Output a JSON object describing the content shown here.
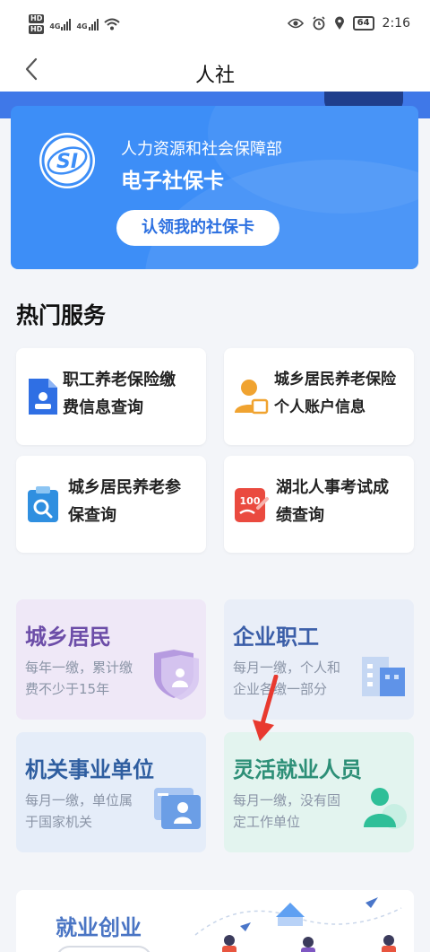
{
  "status_bar": {
    "network_badges": [
      "HD",
      "HD"
    ],
    "network_types": [
      "4G",
      "4G"
    ],
    "battery": "64",
    "time": "2:16"
  },
  "nav": {
    "title": "人社",
    "back_icon": "chevron-left-icon"
  },
  "card": {
    "org": "人力资源和社会保障部",
    "title": "电子社保卡",
    "button": "认领我的社保卡",
    "logo_text": "SI"
  },
  "hot_services": {
    "title": "热门服务",
    "items": [
      {
        "line1": "职工养老保险缴",
        "line2": "费信息查询",
        "icon": "document-icon",
        "color": "#2f6fe4"
      },
      {
        "line1": "城乡居民养老保险",
        "line2": "个人账户信息",
        "icon": "user-card-icon",
        "color": "#f0a330"
      },
      {
        "line1": "城乡居民养老参",
        "line2": "保查询",
        "icon": "search-clipboard-icon",
        "color": "#2f8fe0"
      },
      {
        "line1": "湖北人事考试成",
        "line2": "绩查询",
        "icon": "score-icon",
        "color": "#ea4a3f"
      }
    ]
  },
  "categories": [
    {
      "title": "城乡居民",
      "sub": "每年一缴，累计缴费不少于15年",
      "bg": "#efe8f7",
      "title_color": "#6c4da8",
      "icon": "shield-user-icon"
    },
    {
      "title": "企业职工",
      "sub": "每月一缴，个人和企业各缴一部分",
      "bg": "#e9eef8",
      "title_color": "#3b5ea8",
      "icon": "building-icon"
    },
    {
      "title": "机关事业单位",
      "sub": "每月一缴，单位属于国家机关",
      "bg": "#e5edf9",
      "title_color": "#2f5ea0",
      "icon": "id-card-icon"
    },
    {
      "title": "灵活就业人员",
      "sub": "每月一缴，没有固定工作单位",
      "bg": "#e3f4ef",
      "title_color": "#2d8f77",
      "icon": "person-icon"
    }
  ],
  "bottom": {
    "title": "就业创业"
  },
  "colors": {
    "primary": "#3d8ef7",
    "page_bg": "#f3f5f9",
    "arrow": "#e8392f"
  }
}
